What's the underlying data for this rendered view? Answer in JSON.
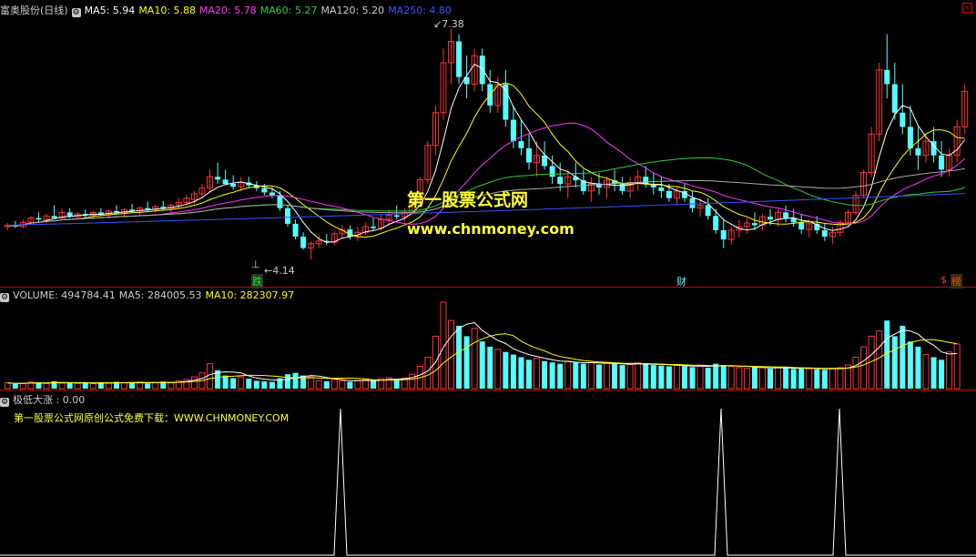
{
  "price_header": {
    "stock": "富奥股份(日线)",
    "ma": [
      {
        "label": "MA5: 5.94",
        "color": "#ffffff"
      },
      {
        "label": "MA10: 5.88",
        "color": "#ffff00"
      },
      {
        "label": "MA20: 5.78",
        "color": "#ff33ff"
      },
      {
        "label": "MA60: 5.27",
        "color": "#33cc33"
      },
      {
        "label": "MA120: 5.20",
        "color": "#cccccc"
      },
      {
        "label": "MA250: 4.80",
        "color": "#3355ff"
      }
    ]
  },
  "price_labels": {
    "high": "7.38",
    "low": "4.14"
  },
  "markers": {
    "die": "跌",
    "cai": "财",
    "bang": "榜",
    "dollar": "$",
    "t": "⊥"
  },
  "watermark": {
    "line1": "第一股票公式网",
    "line2": "www.chnmoney.com"
  },
  "volume_header": {
    "items": [
      {
        "label": "VOLUME: 494784.41",
        "color": "#cccccc"
      },
      {
        "label": "MA5: 284005.53",
        "color": "#cccccc"
      },
      {
        "label": "MA10: 282307.97",
        "color": "#ffff00"
      }
    ]
  },
  "indicator_header": {
    "label": "极低大涨 : 0.00",
    "note": "第一股票公式网原创公式免费下载：WWW.CHNMONEY.COM"
  },
  "colors": {
    "up": "#ff3232",
    "down": "#54ffff",
    "bg": "#000000",
    "divider": "#cc0000"
  },
  "chart_data": [
    {
      "type": "candlestick",
      "title": "富奥股份(日线)",
      "annotated_values": {
        "high": 7.38,
        "low": 4.14
      },
      "ohlc": [
        [
          4.6,
          4.65,
          4.55,
          4.62
        ],
        [
          4.62,
          4.68,
          4.58,
          4.6
        ],
        [
          4.6,
          4.7,
          4.58,
          4.66
        ],
        [
          4.66,
          4.75,
          4.62,
          4.72
        ],
        [
          4.72,
          4.8,
          4.66,
          4.7
        ],
        [
          4.7,
          4.78,
          4.65,
          4.75
        ],
        [
          4.75,
          4.9,
          4.72,
          4.72
        ],
        [
          4.72,
          4.85,
          4.7,
          4.8
        ],
        [
          4.8,
          4.86,
          4.72,
          4.74
        ],
        [
          4.74,
          4.8,
          4.7,
          4.78
        ],
        [
          4.78,
          4.84,
          4.72,
          4.76
        ],
        [
          4.76,
          4.82,
          4.7,
          4.8
        ],
        [
          4.8,
          4.86,
          4.75,
          4.78
        ],
        [
          4.78,
          4.84,
          4.74,
          4.82
        ],
        [
          4.82,
          4.9,
          4.78,
          4.8
        ],
        [
          4.8,
          4.86,
          4.74,
          4.84
        ],
        [
          4.84,
          4.92,
          4.8,
          4.82
        ],
        [
          4.82,
          4.88,
          4.76,
          4.86
        ],
        [
          4.86,
          4.95,
          4.82,
          4.84
        ],
        [
          4.84,
          4.9,
          4.8,
          4.88
        ],
        [
          4.88,
          4.96,
          4.84,
          4.86
        ],
        [
          4.86,
          4.92,
          4.8,
          4.9
        ],
        [
          4.9,
          5.0,
          4.86,
          4.94
        ],
        [
          4.94,
          5.05,
          4.9,
          5.0
        ],
        [
          4.98,
          5.1,
          4.92,
          5.06
        ],
        [
          5.06,
          5.2,
          5.0,
          5.14
        ],
        [
          5.14,
          5.4,
          5.1,
          5.3
        ],
        [
          5.3,
          5.5,
          5.2,
          5.26
        ],
        [
          5.26,
          5.4,
          5.18,
          5.2
        ],
        [
          5.2,
          5.32,
          5.12,
          5.16
        ],
        [
          5.16,
          5.3,
          5.1,
          5.22
        ],
        [
          5.22,
          5.3,
          5.14,
          5.18
        ],
        [
          5.18,
          5.24,
          5.1,
          5.14
        ],
        [
          5.14,
          5.2,
          5.04,
          5.08
        ],
        [
          5.08,
          5.16,
          5.0,
          5.04
        ],
        [
          5.04,
          5.1,
          4.82,
          4.86
        ],
        [
          4.86,
          4.9,
          4.6,
          4.64
        ],
        [
          4.64,
          4.7,
          4.42,
          4.46
        ],
        [
          4.46,
          4.52,
          4.28,
          4.3
        ],
        [
          4.3,
          4.4,
          4.14,
          4.36
        ],
        [
          4.36,
          4.48,
          4.3,
          4.4
        ],
        [
          4.4,
          4.5,
          4.34,
          4.38
        ],
        [
          4.38,
          4.54,
          4.34,
          4.5
        ],
        [
          4.5,
          4.62,
          4.44,
          4.56
        ],
        [
          4.56,
          4.62,
          4.42,
          4.46
        ],
        [
          4.46,
          4.6,
          4.4,
          4.52
        ],
        [
          4.52,
          4.66,
          4.48,
          4.6
        ],
        [
          4.6,
          4.72,
          4.54,
          4.58
        ],
        [
          4.58,
          4.76,
          4.54,
          4.7
        ],
        [
          4.7,
          4.84,
          4.64,
          4.76
        ],
        [
          4.76,
          4.9,
          4.7,
          4.74
        ],
        [
          4.74,
          4.86,
          4.66,
          4.8
        ],
        [
          4.8,
          5.0,
          4.76,
          4.94
        ],
        [
          4.94,
          5.3,
          4.9,
          5.26
        ],
        [
          5.26,
          5.8,
          5.2,
          5.74
        ],
        [
          5.74,
          6.3,
          5.6,
          6.2
        ],
        [
          6.2,
          7.1,
          6.1,
          6.9
        ],
        [
          6.9,
          7.38,
          6.6,
          7.2
        ],
        [
          7.2,
          7.3,
          6.6,
          6.7
        ],
        [
          6.7,
          7.0,
          6.4,
          6.6
        ],
        [
          6.6,
          7.1,
          6.5,
          7.0
        ],
        [
          7.0,
          7.1,
          6.5,
          6.6
        ],
        [
          6.6,
          6.8,
          6.2,
          6.3
        ],
        [
          6.3,
          6.7,
          6.2,
          6.6
        ],
        [
          6.6,
          6.8,
          6.0,
          6.1
        ],
        [
          6.1,
          6.3,
          5.7,
          5.8
        ],
        [
          5.8,
          6.1,
          5.6,
          5.7
        ],
        [
          5.7,
          5.9,
          5.4,
          5.5
        ],
        [
          5.5,
          5.8,
          5.3,
          5.6
        ],
        [
          5.6,
          5.8,
          5.4,
          5.45
        ],
        [
          5.45,
          5.6,
          5.2,
          5.3
        ],
        [
          5.3,
          5.5,
          5.1,
          5.2
        ],
        [
          5.2,
          5.4,
          5.0,
          5.3
        ],
        [
          5.3,
          5.5,
          5.15,
          5.25
        ],
        [
          5.25,
          5.4,
          5.05,
          5.1
        ],
        [
          5.1,
          5.3,
          4.95,
          5.2
        ],
        [
          5.2,
          5.35,
          5.05,
          5.15
        ],
        [
          5.15,
          5.3,
          5.0,
          5.25
        ],
        [
          5.25,
          5.4,
          5.1,
          5.2
        ],
        [
          5.2,
          5.3,
          5.05,
          5.1
        ],
        [
          5.1,
          5.3,
          5.0,
          5.22
        ],
        [
          5.22,
          5.4,
          5.1,
          5.3
        ],
        [
          5.3,
          5.45,
          5.15,
          5.2
        ],
        [
          5.2,
          5.35,
          5.05,
          5.15
        ],
        [
          5.15,
          5.3,
          5.0,
          5.1
        ],
        [
          5.1,
          5.2,
          4.95,
          5.0
        ],
        [
          5.0,
          5.15,
          4.9,
          5.1
        ],
        [
          5.1,
          5.2,
          4.95,
          5.0
        ],
        [
          5.0,
          5.1,
          4.8,
          4.86
        ],
        [
          4.86,
          5.0,
          4.74,
          4.9
        ],
        [
          4.9,
          5.0,
          4.7,
          4.75
        ],
        [
          4.75,
          4.85,
          4.5,
          4.55
        ],
        [
          4.55,
          4.7,
          4.3,
          4.42
        ],
        [
          4.42,
          4.6,
          4.35,
          4.55
        ],
        [
          4.55,
          4.7,
          4.45,
          4.6
        ],
        [
          4.6,
          4.72,
          4.5,
          4.65
        ],
        [
          4.65,
          4.8,
          4.55,
          4.62
        ],
        [
          4.62,
          4.78,
          4.55,
          4.74
        ],
        [
          4.74,
          4.85,
          4.62,
          4.7
        ],
        [
          4.7,
          4.85,
          4.6,
          4.8
        ],
        [
          4.8,
          4.9,
          4.66,
          4.72
        ],
        [
          4.72,
          4.85,
          4.6,
          4.66
        ],
        [
          4.66,
          4.78,
          4.5,
          4.56
        ],
        [
          4.56,
          4.7,
          4.45,
          4.64
        ],
        [
          4.64,
          4.75,
          4.5,
          4.55
        ],
        [
          4.55,
          4.65,
          4.4,
          4.46
        ],
        [
          4.46,
          4.6,
          4.36,
          4.52
        ],
        [
          4.52,
          4.7,
          4.46,
          4.66
        ],
        [
          4.66,
          4.84,
          4.6,
          4.8
        ],
        [
          4.8,
          5.1,
          4.76,
          5.04
        ],
        [
          5.04,
          5.4,
          5.0,
          5.36
        ],
        [
          5.36,
          6.0,
          5.3,
          5.9
        ],
        [
          5.9,
          6.9,
          5.8,
          6.8
        ],
        [
          6.8,
          7.3,
          6.4,
          6.6
        ],
        [
          6.6,
          6.9,
          6.1,
          6.2
        ],
        [
          6.2,
          6.6,
          5.9,
          6.0
        ],
        [
          6.0,
          6.3,
          5.6,
          5.7
        ],
        [
          5.7,
          6.0,
          5.4,
          5.6
        ],
        [
          5.6,
          5.9,
          5.5,
          5.8
        ],
        [
          5.8,
          6.0,
          5.5,
          5.6
        ],
        [
          5.6,
          5.8,
          5.3,
          5.4
        ],
        [
          5.4,
          5.7,
          5.3,
          5.6
        ],
        [
          5.6,
          6.1,
          5.5,
          6.0
        ],
        [
          6.0,
          6.6,
          5.9,
          6.5
        ]
      ],
      "ma_lines": [
        "MA5",
        "MA10",
        "MA20",
        "MA60",
        "MA120",
        "MA250"
      ]
    },
    {
      "type": "bar",
      "title": "VOLUME",
      "values": [
        22,
        18,
        20,
        25,
        24,
        19,
        28,
        21,
        23,
        20,
        22,
        19,
        24,
        21,
        26,
        23,
        22,
        25,
        20,
        24,
        27,
        22,
        30,
        35,
        45,
        60,
        95,
        70,
        50,
        40,
        45,
        38,
        30,
        28,
        26,
        40,
        55,
        60,
        50,
        45,
        30,
        28,
        35,
        30,
        26,
        32,
        34,
        30,
        38,
        42,
        36,
        40,
        55,
        85,
        120,
        200,
        330,
        260,
        240,
        200,
        230,
        180,
        160,
        150,
        140,
        130,
        120,
        110,
        115,
        105,
        100,
        95,
        105,
        100,
        95,
        100,
        92,
        98,
        95,
        90,
        92,
        98,
        94,
        90,
        88,
        85,
        90,
        86,
        82,
        88,
        80,
        95,
        90,
        85,
        80,
        78,
        82,
        80,
        76,
        82,
        78,
        75,
        80,
        76,
        74,
        72,
        78,
        80,
        90,
        120,
        160,
        200,
        220,
        260,
        200,
        240,
        180,
        160,
        130,
        120,
        110,
        140,
        170
      ],
      "ma_lines": [
        "MA5",
        "MA10"
      ]
    },
    {
      "type": "line",
      "title": "极低大涨",
      "values_note": "spikes to maximum at three bars, zero otherwise"
    }
  ]
}
